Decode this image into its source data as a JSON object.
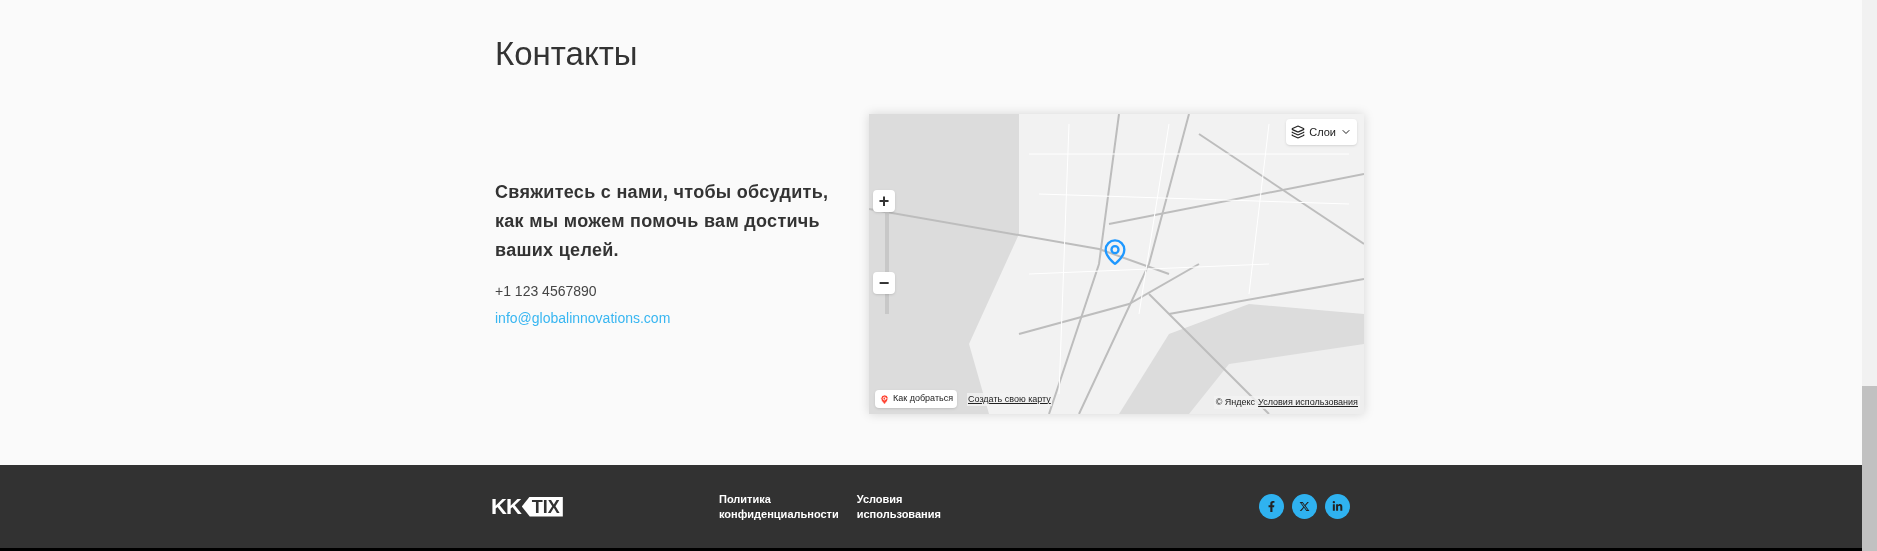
{
  "heading": "Контакты",
  "contact": {
    "tagline": "Свяжитесь с нами, чтобы обсудить, как мы можем помочь вам достичь ваших целей.",
    "phone": "+1 123 4567890",
    "email": "info@globalinnovations.com"
  },
  "map": {
    "zoom_in": "+",
    "zoom_out": "−",
    "layers": "Слои",
    "directions": "Как добраться",
    "create_map": "Создать свою карту",
    "copyright": "© Яндекс",
    "terms": "Условия использования"
  },
  "footer": {
    "logo": {
      "part_1": "KK",
      "part_2": "TIX"
    },
    "links": [
      {
        "line_1": "Политика",
        "line_2": "конфиденциальности"
      },
      {
        "line_1": "Условия",
        "line_2": "использования"
      }
    ],
    "social": [
      {
        "kind": "facebook"
      },
      {
        "kind": "x"
      },
      {
        "kind": "linkedin"
      }
    ]
  }
}
